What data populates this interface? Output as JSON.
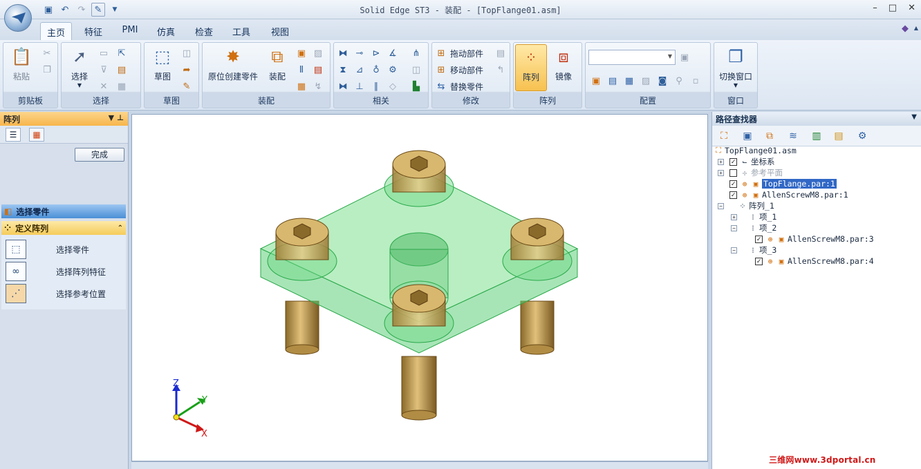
{
  "window": {
    "title": "Solid Edge ST3 - 装配 - [TopFlange01.asm]",
    "controls": [
      "–",
      "□",
      "✕"
    ]
  },
  "quick_access": [
    "save-icon",
    "undo-icon",
    "redo-icon",
    "pattern-icon",
    "customize-icon"
  ],
  "tabs": [
    "主页",
    "特征",
    "PMI",
    "仿真",
    "检查",
    "工具",
    "视图"
  ],
  "active_tab": "主页",
  "ribbon": {
    "clipboard": {
      "label": "剪贴板",
      "paste": "粘贴"
    },
    "select": {
      "label": "选择",
      "select": "选择"
    },
    "sketch": {
      "label": "草图",
      "sketch": "草图"
    },
    "assemble": {
      "label": "装配",
      "create_in_place": "原位创建零件",
      "assemble": "装配"
    },
    "relate": {
      "label": "相关"
    },
    "modify": {
      "label": "修改",
      "drag": "拖动部件",
      "move": "移动部件",
      "replace": "替换零件"
    },
    "pattern": {
      "label": "阵列",
      "pattern": "阵列",
      "mirror": "镜像"
    },
    "configure": {
      "label": "配置"
    },
    "window": {
      "label": "窗口",
      "switch": "切换窗口"
    }
  },
  "left_pane": {
    "title": "阵列",
    "done_button": "完成",
    "step1": "选择零件",
    "step2": "定义阵列",
    "items": [
      "选择零件",
      "选择阵列特征",
      "选择参考位置"
    ]
  },
  "pathfinder": {
    "title": "路径查找器",
    "root": "TopFlange01.asm",
    "nodes": [
      {
        "label": "坐标系",
        "checked": true
      },
      {
        "label": "参考平面",
        "checked": false
      },
      {
        "label": "TopFlange.par:1",
        "checked": true,
        "selected": true
      },
      {
        "label": "AllenScrewM8.par:1",
        "checked": true
      },
      {
        "label": "阵列_1"
      },
      {
        "label": "项_1"
      },
      {
        "label": "项_2"
      },
      {
        "label": "AllenScrewM8.par:3",
        "checked": true
      },
      {
        "label": "项_3"
      },
      {
        "label": "AllenScrewM8.par:4",
        "checked": true
      }
    ]
  },
  "axes": {
    "x": "X",
    "y": "Y",
    "z": "Z"
  },
  "watermark": "三维网www.3dportal.cn",
  "colors": {
    "flange": "#5fd07a",
    "screw": "#c9a050",
    "accent": "#f7b54b"
  }
}
